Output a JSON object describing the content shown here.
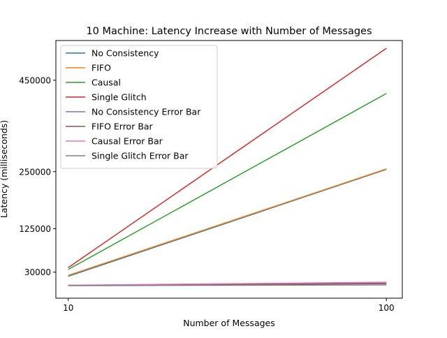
{
  "chart_data": {
    "type": "line",
    "title": "10 Machine: Latency Increase with Number of Messages",
    "xlabel": "Number of Messages",
    "ylabel": "Latency (milliseconds)",
    "x": [
      10,
      100
    ],
    "xticks": [
      10,
      100
    ],
    "xtick_labels": [
      "10",
      "100"
    ],
    "yticks": [
      30000,
      125000,
      250000,
      450000
    ],
    "ytick_labels": [
      "30000",
      "125000",
      "250000",
      "450000"
    ],
    "xlim": [
      6.5,
      104.5
    ],
    "ylim": [
      -27000,
      537000
    ],
    "grid": false,
    "legend_position": "upper left",
    "series": [
      {
        "name": "No Consistency",
        "color": "#1f77b4",
        "values": [
          21000,
          255000
        ]
      },
      {
        "name": "FIFO",
        "color": "#ff7f0e",
        "values": [
          23000,
          256000
        ]
      },
      {
        "name": "Causal",
        "color": "#2ca02c",
        "values": [
          36000,
          421000
        ]
      },
      {
        "name": "Single Glitch",
        "color": "#d62728",
        "values": [
          40000,
          520000
        ]
      },
      {
        "name": "No Consistency Error Bar",
        "color": "#9467bd",
        "values": [
          1000,
          7000
        ]
      },
      {
        "name": "FIFO Error Bar",
        "color": "#8c564b",
        "values": [
          1000,
          5000
        ]
      },
      {
        "name": "Causal Error Bar",
        "color": "#e377c2",
        "values": [
          1500,
          8000
        ]
      },
      {
        "name": "Single Glitch Error Bar",
        "color": "#7f7f7f",
        "values": [
          500,
          2000
        ]
      }
    ]
  }
}
